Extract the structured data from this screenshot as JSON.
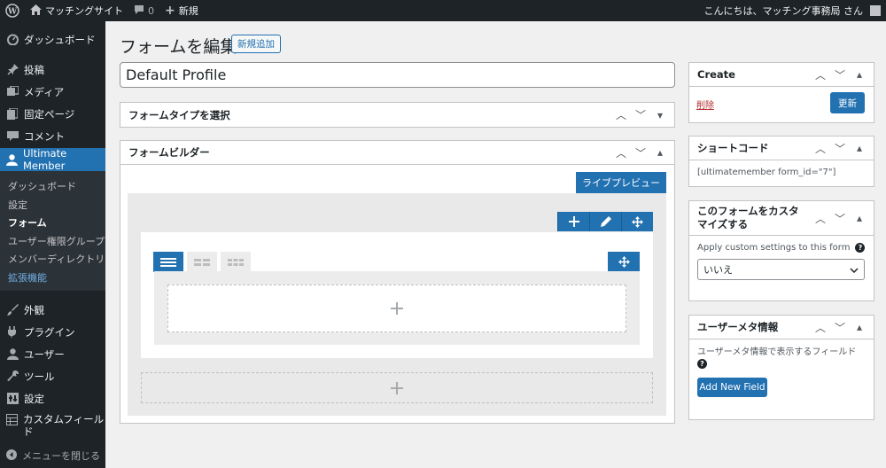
{
  "adminbar": {
    "site_name": "マッチングサイト",
    "comments_count": "0",
    "new_label": "新規",
    "greeting": "こんにちは、マッチング事務局 さん"
  },
  "sidebar": {
    "items": [
      {
        "label": "ダッシュボード",
        "icon": "dashboard-icon"
      },
      {
        "label": "投稿",
        "icon": "pin-icon"
      },
      {
        "label": "メディア",
        "icon": "media-icon"
      },
      {
        "label": "固定ページ",
        "icon": "page-icon"
      },
      {
        "label": "コメント",
        "icon": "comment-icon"
      },
      {
        "label": "Ultimate Member",
        "icon": "user-icon"
      }
    ],
    "submenu": [
      "ダッシュボード",
      "設定",
      "フォーム",
      "ユーザー権限グループ",
      "メンバーディレクトリ",
      "拡張機能"
    ],
    "items2": [
      {
        "label": "外観",
        "icon": "brush-icon"
      },
      {
        "label": "プラグイン",
        "icon": "plugin-icon"
      },
      {
        "label": "ユーザー",
        "icon": "users-icon"
      },
      {
        "label": "ツール",
        "icon": "wrench-icon"
      },
      {
        "label": "設定",
        "icon": "settings-icon"
      },
      {
        "label": "カスタムフィールド",
        "icon": "grid-icon"
      }
    ],
    "collapse_label": "メニューを閉じる"
  },
  "header": {
    "title": "フォームを編集",
    "add_new": "新規追加"
  },
  "form": {
    "title_value": "Default Profile",
    "type_box_title": "フォームタイプを選択",
    "builder_title": "フォームビルダー",
    "live_preview": "ライブプレビュー"
  },
  "side": {
    "create": {
      "title": "Create",
      "delete": "削除",
      "update": "更新"
    },
    "shortcode": {
      "title": "ショートコード",
      "code": "[ultimatemember form_id=\"7\"]"
    },
    "customize": {
      "title": "このフォームをカスタマイズする",
      "label": "Apply custom settings to this form",
      "selected": "いいえ"
    },
    "usermeta": {
      "title": "ユーザーメタ情報",
      "description": "ユーザーメタ情報で表示するフィールド",
      "button": "Add New Field"
    }
  },
  "colors": {
    "accent": "#2271b1",
    "adminbar": "#1d2327",
    "delete": "#b32d2e"
  }
}
